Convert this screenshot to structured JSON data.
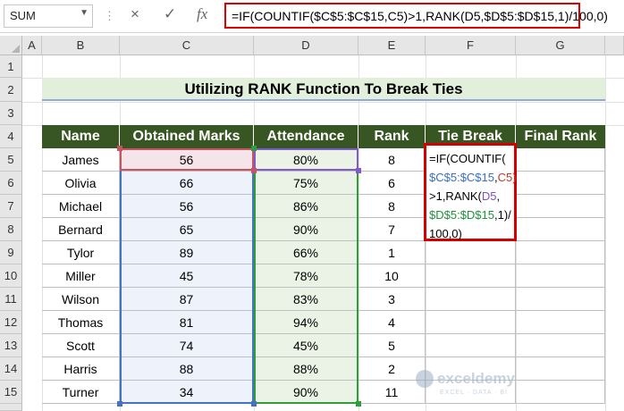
{
  "formula_bar": {
    "name_box": "SUM",
    "cancel_icon": "×",
    "enter_icon": "✓",
    "fx_label": "fx",
    "formula": "=IF(COUNTIF($C$5:$C$15,C5)>1,RANK(D5,$D$5:$D$15,1)/100,0)"
  },
  "columns": [
    "A",
    "B",
    "C",
    "D",
    "E",
    "F",
    "G"
  ],
  "rows": [
    "1",
    "2",
    "3",
    "4",
    "5",
    "6",
    "7",
    "8",
    "9",
    "10",
    "11",
    "12",
    "13",
    "14",
    "15"
  ],
  "title": "Utilizing RANK Function To Break Ties",
  "table": {
    "headers": [
      "Name",
      "Obtained Marks",
      "Attendance",
      "Rank",
      "Tie Break",
      "Final Rank"
    ],
    "rows": [
      {
        "name": "James",
        "marks": "56",
        "attendance": "80%",
        "rank": "8"
      },
      {
        "name": "Olivia",
        "marks": "66",
        "attendance": "75%",
        "rank": "6"
      },
      {
        "name": "Michael",
        "marks": "56",
        "attendance": "86%",
        "rank": "8"
      },
      {
        "name": "Bernard",
        "marks": "65",
        "attendance": "90%",
        "rank": "7"
      },
      {
        "name": "Tylor",
        "marks": "89",
        "attendance": "66%",
        "rank": "1"
      },
      {
        "name": "Miller",
        "marks": "45",
        "attendance": "78%",
        "rank": "10"
      },
      {
        "name": "Wilson",
        "marks": "87",
        "attendance": "83%",
        "rank": "3"
      },
      {
        "name": "Thomas",
        "marks": "81",
        "attendance": "94%",
        "rank": "4"
      },
      {
        "name": "Scott",
        "marks": "74",
        "attendance": "45%",
        "rank": "5"
      },
      {
        "name": "Harris",
        "marks": "88",
        "attendance": "88%",
        "rank": "2"
      },
      {
        "name": "Turner",
        "marks": "34",
        "attendance": "90%",
        "rank": "11"
      }
    ]
  },
  "cell_f5_formula": {
    "l1": "=IF(COUNTIF(",
    "l2a": "$C$5:$C$15",
    "l2b": ",",
    "l2c": "C5)",
    "l3a": ">1,RANK(",
    "l3b": "D5",
    "l3c": ",",
    "l4a": "$D$5:$D$15",
    "l4b": ",1)/",
    "l5": "100,0)"
  },
  "watermark": {
    "name": "exceldemy",
    "tagline": "EXCEL · DATA · BI"
  },
  "colors": {
    "header_fill": "#375623",
    "title_fill": "#e2efda",
    "formula_highlight": "#e00000",
    "range_c": "#4472c4",
    "range_d": "#2e9d3a"
  }
}
